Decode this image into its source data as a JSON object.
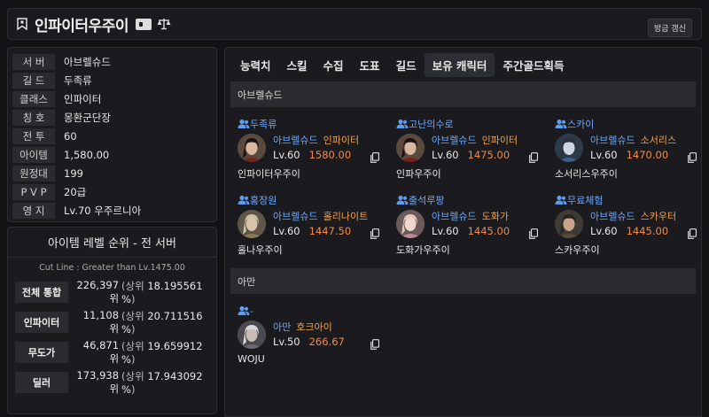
{
  "header": {
    "title": "인파이터우주이",
    "refresh_label": "방금 갱신"
  },
  "info": [
    {
      "label": "서 버",
      "value": "아브렐슈드"
    },
    {
      "label": "길 드",
      "value": "두족류"
    },
    {
      "label": "클래스",
      "value": "인파이터"
    },
    {
      "label": "칭 호",
      "value": "몽환군단장"
    },
    {
      "label": "전 투",
      "value": "60"
    },
    {
      "label": "아이템",
      "value": "1,580.00"
    },
    {
      "label": "원정대",
      "value": "199"
    },
    {
      "label": "P V P",
      "value": "20급"
    },
    {
      "label": "영 지",
      "value": "Lv.70 우주르니아"
    }
  ],
  "rank": {
    "title": "아이템 레벨 순위 - 전 서버",
    "cutline": "Cut Line : Greater than Lv.1475.00",
    "rows": [
      {
        "label": "전체 통합",
        "count": "226,397",
        "unit": "위",
        "pct": "18.195561 %"
      },
      {
        "label": "인파이터",
        "count": "11,108",
        "unit": "위",
        "pct": "20.711516 %"
      },
      {
        "label": "무도가",
        "count": "46,871",
        "unit": "위",
        "pct": "19.659912 %"
      },
      {
        "label": "딜러",
        "count": "173,938",
        "unit": "위",
        "pct": "17.943092 %"
      }
    ],
    "paren_open": "(상위",
    "paren_close": ")"
  },
  "tabs": [
    "능력치",
    "스킬",
    "수집",
    "도표",
    "길드",
    "보유 캐릭터",
    "주간골드획득"
  ],
  "active_tab": "보유 캐릭터",
  "groups": [
    {
      "server": "아브렐슈드",
      "characters": [
        {
          "guild": "두족류",
          "server": "아브렐슈드",
          "class": "인파이터",
          "level": "Lv.60",
          "item_level": "1580.00",
          "name": "인파이터우주이",
          "avatar": "infighter"
        },
        {
          "guild": "고난의수로",
          "server": "아브렐슈드",
          "class": "인파이터",
          "level": "Lv.60",
          "item_level": "1475.00",
          "name": "인파우주이",
          "avatar": "infighter"
        },
        {
          "guild": "스카이",
          "server": "아브렐슈드",
          "class": "소서리스",
          "level": "Lv.60",
          "item_level": "1470.00",
          "name": "소서리스우주이",
          "avatar": "sorceress"
        },
        {
          "guild": "홍장원",
          "server": "아브렐슈드",
          "class": "홀리나이트",
          "level": "Lv.60",
          "item_level": "1447.50",
          "name": "홀나우주이",
          "avatar": "holyknight"
        },
        {
          "guild": "출석루팡",
          "server": "아브렐슈드",
          "class": "도화가",
          "level": "Lv.60",
          "item_level": "1445.00",
          "name": "도화가우주이",
          "avatar": "artist"
        },
        {
          "guild": "무료체험",
          "server": "아브렐슈드",
          "class": "스카우터",
          "level": "Lv.60",
          "item_level": "1445.00",
          "name": "스카우주이",
          "avatar": "scouter"
        }
      ]
    },
    {
      "server": "아만",
      "characters": [
        {
          "guild": "-",
          "server": "아만",
          "class": "호크아이",
          "level": "Lv.50",
          "item_level": "266.67",
          "name": "WOJU",
          "avatar": "hawkeye"
        }
      ]
    }
  ],
  "colors": {
    "accent_blue": "#6aa9ff",
    "class_orange": "#f0a14a",
    "item_level_orange": "#f08a4b"
  }
}
